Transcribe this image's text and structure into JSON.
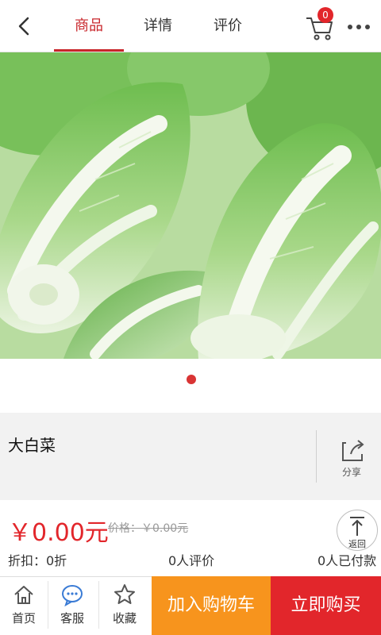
{
  "header": {
    "tabs": [
      {
        "label": "商品",
        "active": true
      },
      {
        "label": "详情",
        "active": false
      },
      {
        "label": "评价",
        "active": false
      }
    ],
    "cart_count": "0",
    "accent_color": "#c8262b"
  },
  "gallery": {
    "image_subject": "napa cabbage (大白菜) heads",
    "page_count": 1,
    "active_index": 0
  },
  "product": {
    "name": "大白菜",
    "share_label": "分享",
    "price": "￥0.00元",
    "original_price": "价格：￥0.00元",
    "discount": "折扣：0折",
    "review_count": "0人评价",
    "paid_count": "0人已付款",
    "back_label": "返回"
  },
  "bottom_bar": {
    "home": "首页",
    "service": "客服",
    "favorite": "收藏",
    "add_to_cart": "加入购物车",
    "buy_now": "立即购买",
    "add_color": "#f7941d",
    "buy_color": "#e2262b"
  }
}
